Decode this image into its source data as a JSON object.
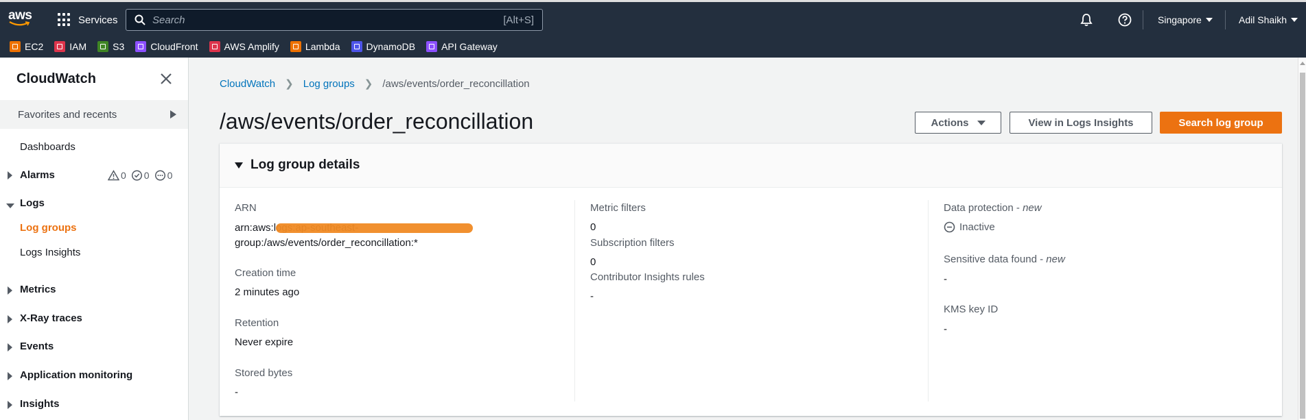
{
  "topnav": {
    "logo": "aws",
    "services_label": "Services",
    "search_placeholder": "Search",
    "search_shortcut": "[Alt+S]",
    "region": "Singapore",
    "user": "Adil Shaikh",
    "icons": [
      "grid-icon",
      "search-icon",
      "bell-icon",
      "help-icon",
      "caret-down-icon"
    ]
  },
  "favorites": [
    {
      "label": "EC2",
      "color": "#ed7100"
    },
    {
      "label": "IAM",
      "color": "#dd344c"
    },
    {
      "label": "S3",
      "color": "#3f8624"
    },
    {
      "label": "CloudFront",
      "color": "#8c4fff"
    },
    {
      "label": "AWS Amplify",
      "color": "#dd344c"
    },
    {
      "label": "Lambda",
      "color": "#ed7100"
    },
    {
      "label": "DynamoDB",
      "color": "#4d54e8"
    },
    {
      "label": "API Gateway",
      "color": "#8c4fff"
    }
  ],
  "sidebar": {
    "title": "CloudWatch",
    "favorites_label": "Favorites and recents",
    "items": {
      "dashboards": "Dashboards",
      "alarms": "Alarms",
      "alarm_counts": [
        "0",
        "0",
        "0"
      ],
      "logs": "Logs",
      "log_groups": "Log groups",
      "logs_insights": "Logs Insights",
      "metrics": "Metrics",
      "xray": "X-Ray traces",
      "events": "Events",
      "app_monitoring": "Application monitoring",
      "insights": "Insights"
    }
  },
  "breadcrumb": {
    "root": "CloudWatch",
    "parent": "Log groups",
    "current": "/aws/events/order_reconcillation"
  },
  "page": {
    "title": "/aws/events/order_reconcillation",
    "actions_label": "Actions",
    "view_insights_label": "View in Logs Insights",
    "search_label": "Search log group"
  },
  "details": {
    "header": "Log group details",
    "arn_label": "ARN",
    "arn_line1": "arn:aws:logs:ap-southeast-",
    "arn_line2": "group:/aws/events/order_reconcillation:*",
    "creation_label": "Creation time",
    "creation_value": "2 minutes ago",
    "retention_label": "Retention",
    "retention_value": "Never expire",
    "stored_label": "Stored bytes",
    "stored_value": "-",
    "metric_filters_label": "Metric filters",
    "metric_filters_value": "0",
    "subscription_label": "Subscription filters",
    "subscription_value": "0",
    "contributor_label": "Contributor Insights rules",
    "contributor_value": "-",
    "data_protection_label": "Data protection - ",
    "data_protection_new": "new",
    "data_protection_value": "Inactive",
    "sensitive_label": "Sensitive data found - ",
    "sensitive_new": "new",
    "sensitive_value": "-",
    "kms_label": "KMS key ID",
    "kms_value": "-"
  }
}
